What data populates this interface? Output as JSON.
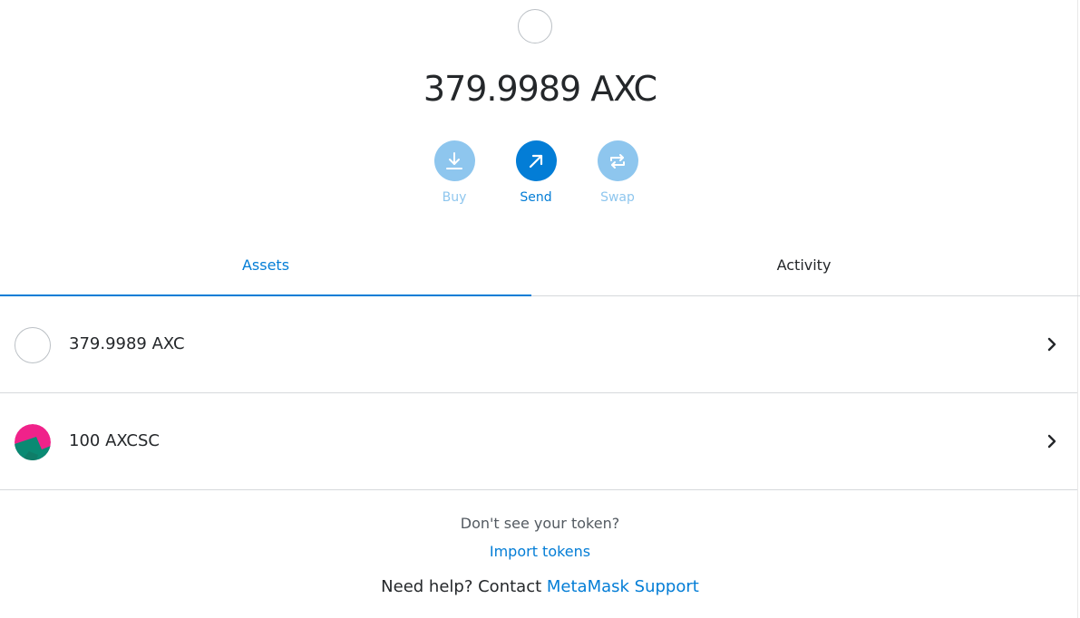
{
  "overview": {
    "balance": "379.9989 AXC",
    "token_icon": "token-placeholder-circle"
  },
  "actions": {
    "buy_label": "Buy",
    "send_label": "Send",
    "swap_label": "Swap",
    "buy_icon": "download-arrow-icon",
    "send_icon": "arrow-up-right-icon",
    "swap_icon": "swap-arrows-icon"
  },
  "tabs": {
    "assets_label": "Assets",
    "activity_label": "Activity",
    "active": "Assets"
  },
  "assets": [
    {
      "label": "379.9989 AXC",
      "icon": "token-placeholder-circle"
    },
    {
      "label": "100 AXCSC",
      "icon": "identicon"
    }
  ],
  "footer": {
    "question": "Don't see your token?",
    "import_label": "Import tokens",
    "help_prefix": "Need help? Contact",
    "support_link": "MetaMask Support"
  },
  "colors": {
    "primary": "#037dd6",
    "primary_light": "#8ec6ee",
    "text": "#24272a",
    "muted": "#535a61",
    "border": "#d6d9dc",
    "identicon_pink": "#f0228a",
    "identicon_teal": "#0a8a73"
  }
}
